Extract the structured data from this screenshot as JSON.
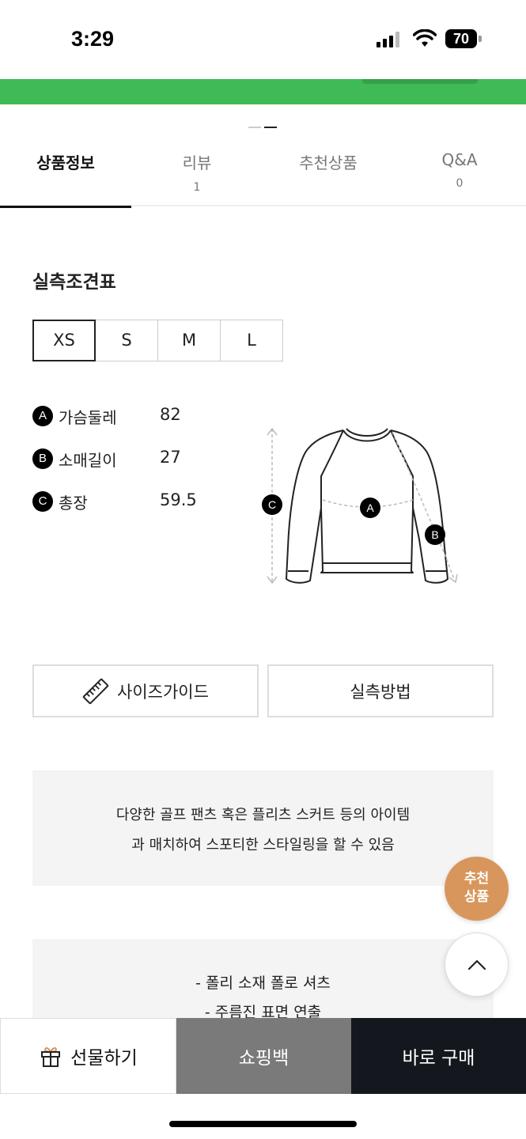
{
  "status_bar": {
    "time": "3:29",
    "battery": "70"
  },
  "tabs": [
    {
      "label": "상품정보",
      "count": "",
      "active": true
    },
    {
      "label": "리뷰",
      "count": "1",
      "active": false
    },
    {
      "label": "추천상품",
      "count": "",
      "active": false
    },
    {
      "label": "Q&A",
      "count": "0",
      "active": false
    }
  ],
  "size_chart": {
    "title": "실측조견표",
    "sizes": [
      "XS",
      "S",
      "M",
      "L"
    ],
    "selected_size": "XS",
    "measurements": [
      {
        "badge": "A",
        "name": "가슴둘레",
        "value": "82"
      },
      {
        "badge": "B",
        "name": "소매길이",
        "value": "27"
      },
      {
        "badge": "C",
        "name": "총장",
        "value": "59.5"
      }
    ],
    "diagram_badges": {
      "a": "A",
      "b": "B",
      "c": "C"
    }
  },
  "buttons": {
    "size_guide": "사이즈가이드",
    "measure_method": "실측방법"
  },
  "description": {
    "line1": "다양한 골프 팬츠 혹은 플리츠 스커트 등의 아이템",
    "line2": "과 매치하여 스포티한 스타일링을 할 수 있음"
  },
  "features": {
    "line1": "- 폴리 소재 폴로 셔츠",
    "line2": "- 주름진 표면 연출"
  },
  "floating": {
    "recommend_line1": "추천",
    "recommend_line2": "상품"
  },
  "action_bar": {
    "gift": "선물하기",
    "shopping_bag": "쇼핑백",
    "buy_now": "바로 구매"
  },
  "colors": {
    "banner_green": "#3fba56",
    "recommend_orange": "#d9965c",
    "buy_dark": "#14181e",
    "bag_gray": "#7a7a7a"
  },
  "icons": [
    "signal-icon",
    "wifi-icon",
    "battery-icon",
    "ruler-icon",
    "chevron-up-icon",
    "gift-icon"
  ]
}
